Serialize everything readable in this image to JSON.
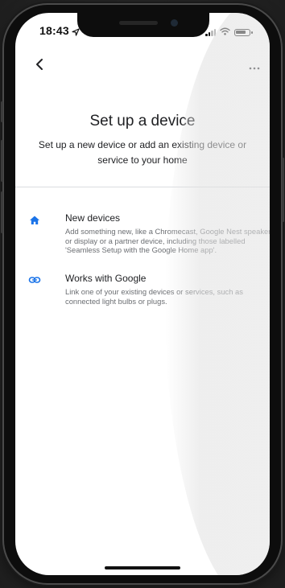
{
  "status_bar": {
    "time": "18:43"
  },
  "header": {
    "back_icon": "chevron-left-icon",
    "more_icon": "more-horizontal-icon"
  },
  "page": {
    "title": "Set up a device",
    "subtitle": "Set up a new device or add an existing device or service to your home"
  },
  "options": [
    {
      "icon": "home-icon",
      "title": "New devices",
      "description": "Add something new, like a Chromecast, Google Nest speaker or display or a partner device, including those labelled 'Seamless Setup with the Google Home app'."
    },
    {
      "icon": "link-icon",
      "title": "Works with Google",
      "description": "Link one of your existing devices or services, such as connected light bulbs or plugs."
    }
  ],
  "colors": {
    "accent": "#1a73e8",
    "text_primary": "#202124",
    "text_secondary": "#6b6e72",
    "divider": "#dadce0"
  }
}
